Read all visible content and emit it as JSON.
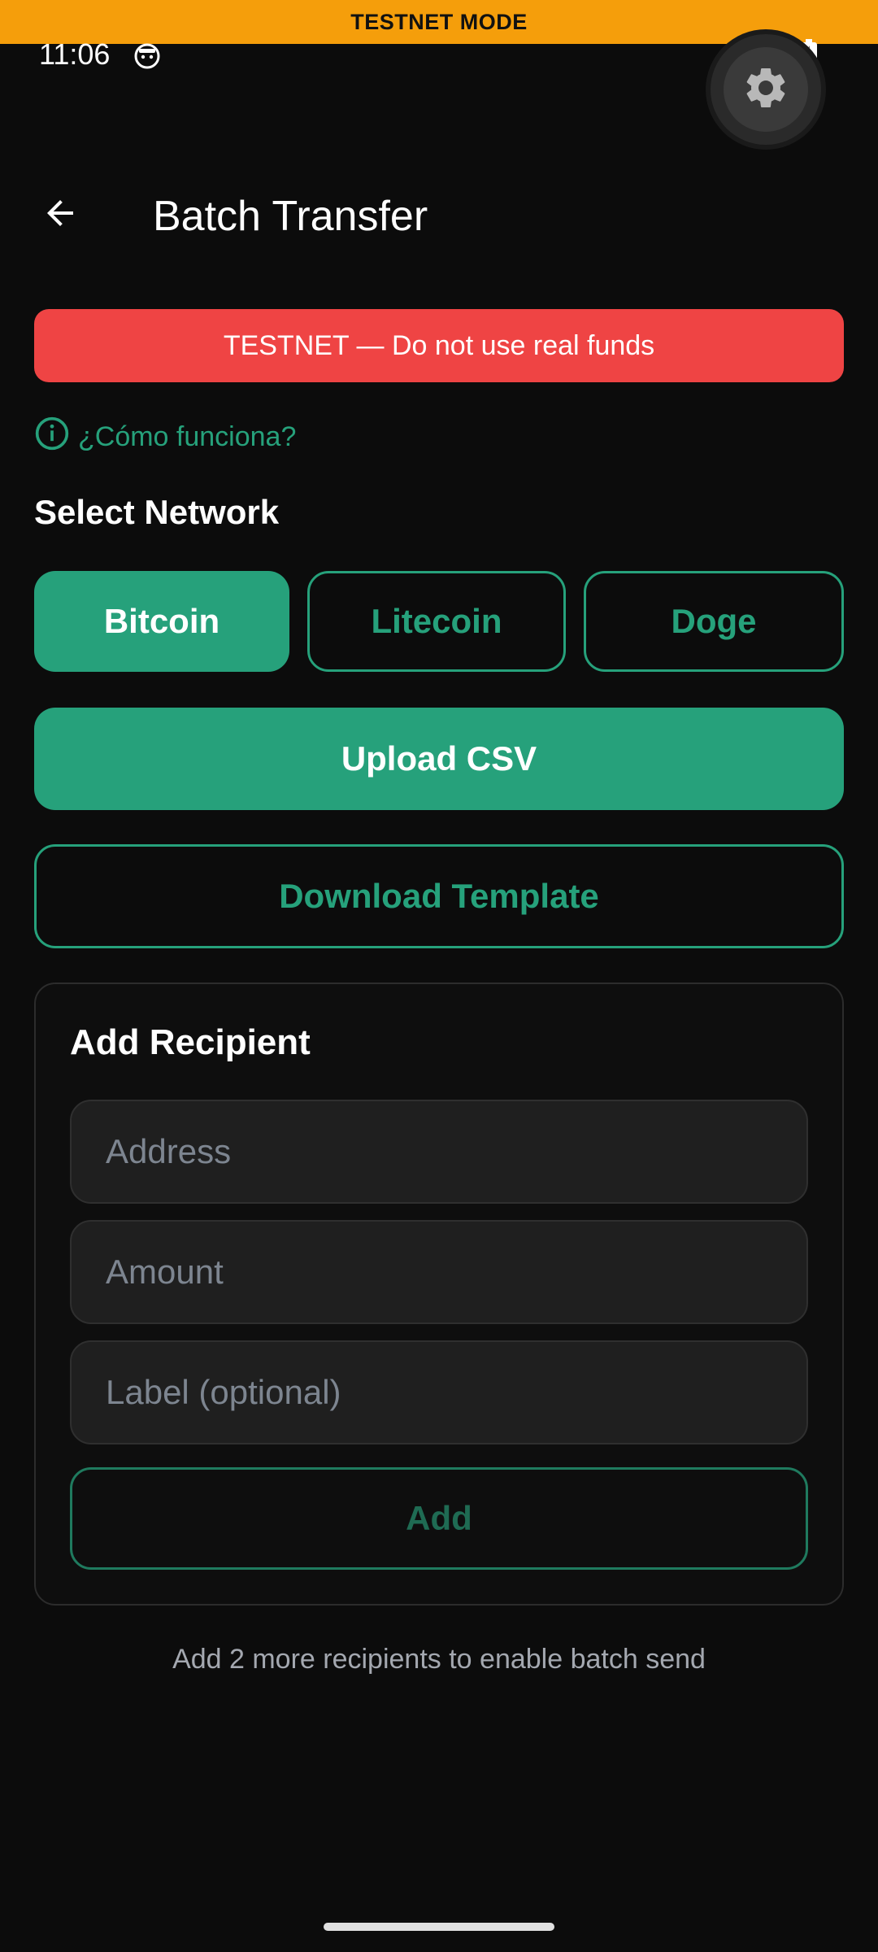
{
  "testnet_bar": {
    "label": "TESTNET MODE"
  },
  "status_bar": {
    "time": "11:06"
  },
  "header": {
    "title": "Batch Transfer"
  },
  "warning": {
    "text": "TESTNET — Do not use real funds"
  },
  "help": {
    "label": "¿Cómo funciona?"
  },
  "network": {
    "label": "Select Network",
    "options": [
      {
        "label": "Bitcoin",
        "selected": true
      },
      {
        "label": "Litecoin",
        "selected": false
      },
      {
        "label": "Doge",
        "selected": false
      }
    ]
  },
  "actions": {
    "upload_label": "Upload CSV",
    "template_label": "Download Template"
  },
  "recipient_form": {
    "title": "Add Recipient",
    "address_placeholder": "Address",
    "amount_placeholder": "Amount",
    "label_placeholder": "Label (optional)",
    "add_label": "Add"
  },
  "hint": "Add 2 more recipients to enable batch send",
  "colors": {
    "accent": "#26a17b",
    "warning": "#ef4444",
    "testnet": "#f59e0b",
    "background": "#0c0c0c"
  },
  "icons": {
    "back": "arrow-left-icon",
    "settings": "gear-icon",
    "info": "info-icon",
    "wifi": "wifi-icon",
    "signal": "signal-icon",
    "battery": "battery-icon"
  }
}
